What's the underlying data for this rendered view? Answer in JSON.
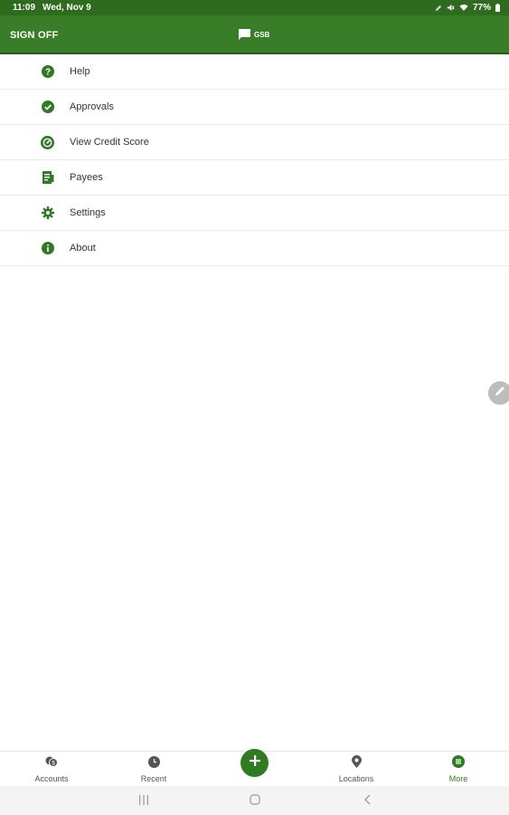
{
  "status_bar": {
    "time": "11:09",
    "date": "Wed, Nov 9",
    "battery": "77%"
  },
  "app_bar": {
    "sign_off": "SIGN OFF",
    "brand": "GSB"
  },
  "menu": {
    "items": [
      {
        "label": "Help",
        "icon": "help-icon"
      },
      {
        "label": "Approvals",
        "icon": "check-circle-icon"
      },
      {
        "label": "View Credit Score",
        "icon": "gauge-icon"
      },
      {
        "label": "Payees",
        "icon": "payee-list-icon"
      },
      {
        "label": "Settings",
        "icon": "gear-icon"
      },
      {
        "label": "About",
        "icon": "info-icon"
      }
    ]
  },
  "bottom_nav": {
    "accounts": "Accounts",
    "recent": "Recent",
    "locations": "Locations",
    "more": "More",
    "active": "more"
  },
  "colors": {
    "status_bar": "#2f6b1f",
    "app_bar": "#3a7d28",
    "accent": "#2f7a22",
    "edit_fab": "#bdbdbd"
  }
}
